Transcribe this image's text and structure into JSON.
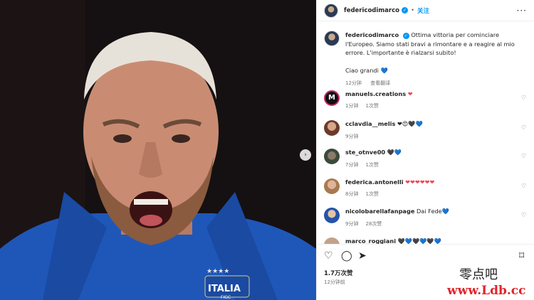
{
  "header": {
    "username": "federicodimarco",
    "verified_glyph": "✓",
    "separator": "•",
    "follow_label": "关注",
    "more_icon": "more-horizontal-icon",
    "more_glyph": "···"
  },
  "photo": {
    "jersey_text": "ITALIA",
    "jersey_subtext": "FIGC",
    "next_glyph": "›"
  },
  "caption": {
    "username": "federicodimarco",
    "text": "Ottima vittoria per cominciare l'Europeo. Siamo stati bravi a rimontare e a reagire al mio errore. L'importante è rialzarsi subito!",
    "sign_off": "Ciao grandi",
    "sign_off_emoji": "💙",
    "time": "12分钟",
    "translate": "查看翻译"
  },
  "comments": [
    {
      "username": "manuels.creations",
      "text": "❤",
      "time": "1分钟",
      "likes": "1次赞"
    },
    {
      "username": "cclavdia__melis",
      "text": "❤😍🖤💙",
      "time": "9分钟",
      "likes": ""
    },
    {
      "username": "ste_otnve00",
      "text": "🖤💙",
      "time": "7分钟",
      "likes": "1次赞"
    },
    {
      "username": "federica.antonelli",
      "text": "❤❤❤❤❤❤",
      "time": "8分钟",
      "likes": "1次赞"
    },
    {
      "username": "nicolobarellafanpage",
      "text": "Dai Fede💙",
      "time": "9分钟",
      "likes": "28次赞"
    },
    {
      "username": "marco_roggiani",
      "text": "🖤💙🖤💙🖤💙",
      "time": "",
      "likes": ""
    }
  ],
  "actions": {
    "like_icon": "heart-icon",
    "like_glyph": "♡",
    "comment_icon": "comment-icon",
    "comment_glyph": "◯",
    "share_icon": "send-icon",
    "share_glyph": "➤",
    "save_icon": "bookmark-icon",
    "save_glyph": "⌑",
    "likes_count": "1.7万次赞",
    "post_time": "12分钟前"
  },
  "comment_like_glyph": "♡",
  "watermark": {
    "line1": "零点吧",
    "line2": "www.Ldb.cc"
  },
  "colors": {
    "link_blue": "#0095f6",
    "heart_red": "#ed4956",
    "secondary": "#737373"
  }
}
